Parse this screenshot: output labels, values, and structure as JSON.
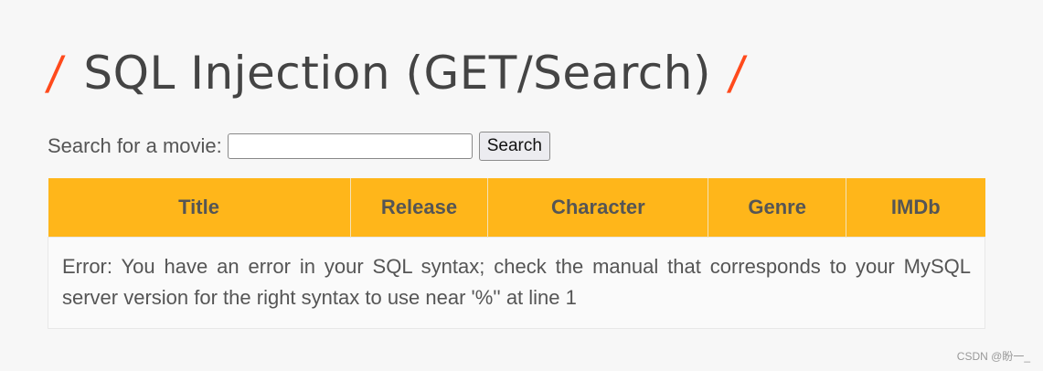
{
  "page": {
    "title": "SQL Injection (GET/Search)",
    "title_slash_left": "/",
    "title_slash_right": "/"
  },
  "search": {
    "label": "Search for a movie:",
    "value": "",
    "placeholder": "",
    "button_label": "Search"
  },
  "table": {
    "headers": [
      "Title",
      "Release",
      "Character",
      "Genre",
      "IMDb"
    ],
    "error_message": "Error: You have an error in your SQL syntax; check the manual that corresponds to your MySQL server version for the right syntax to use near '%'' at line 1"
  },
  "watermark": "CSDN @盼一_",
  "colors": {
    "accent": "#ffb61a",
    "slash": "#ff4a1c",
    "background": "#f7f7f7",
    "text": "#555555"
  }
}
